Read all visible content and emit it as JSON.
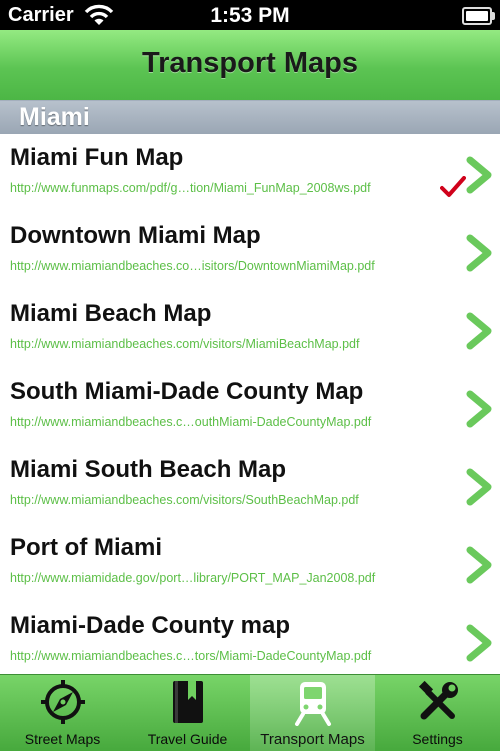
{
  "status_bar": {
    "carrier": "Carrier",
    "time": "1:53 PM"
  },
  "navbar": {
    "title": "Transport Maps"
  },
  "section": {
    "title": "Miami"
  },
  "maps": [
    {
      "name": "Miami Fun Map",
      "url": "http://www.funmaps.com/pdf/g…tion/Miami_FunMap_2008ws.pdf",
      "checked": true
    },
    {
      "name": "Downtown Miami Map",
      "url": "http://www.miamiandbeaches.co…isitors/DowntownMiamiMap.pdf",
      "checked": false
    },
    {
      "name": "Miami Beach Map",
      "url": "http://www.miamiandbeaches.com/visitors/MiamiBeachMap.pdf",
      "checked": false
    },
    {
      "name": "South Miami-Dade County Map",
      "url": "http://www.miamiandbeaches.c…outhMiami-DadeCountyMap.pdf",
      "checked": false
    },
    {
      "name": "Miami South Beach Map",
      "url": "http://www.miamiandbeaches.com/visitors/SouthBeachMap.pdf",
      "checked": false
    },
    {
      "name": "Port of Miami",
      "url": "http://www.miamidade.gov/port…library/PORT_MAP_Jan2008.pdf",
      "checked": false
    },
    {
      "name": "Miami-Dade County map",
      "url": "http://www.miamiandbeaches.c…tors/Miami-DadeCountyMap.pdf",
      "checked": false
    }
  ],
  "tabs": [
    {
      "label": "Street Maps",
      "icon": "compass-icon",
      "active": false
    },
    {
      "label": "Travel Guide",
      "icon": "book-icon",
      "active": false
    },
    {
      "label": "Transport Maps",
      "icon": "train-icon",
      "active": true
    },
    {
      "label": "Settings",
      "icon": "tools-icon",
      "active": false
    }
  ],
  "colors": {
    "accent_green": "#5cc453",
    "url_green": "#5cbf47",
    "check_red": "#d0021b",
    "chevron_green": "#6ac95c"
  }
}
